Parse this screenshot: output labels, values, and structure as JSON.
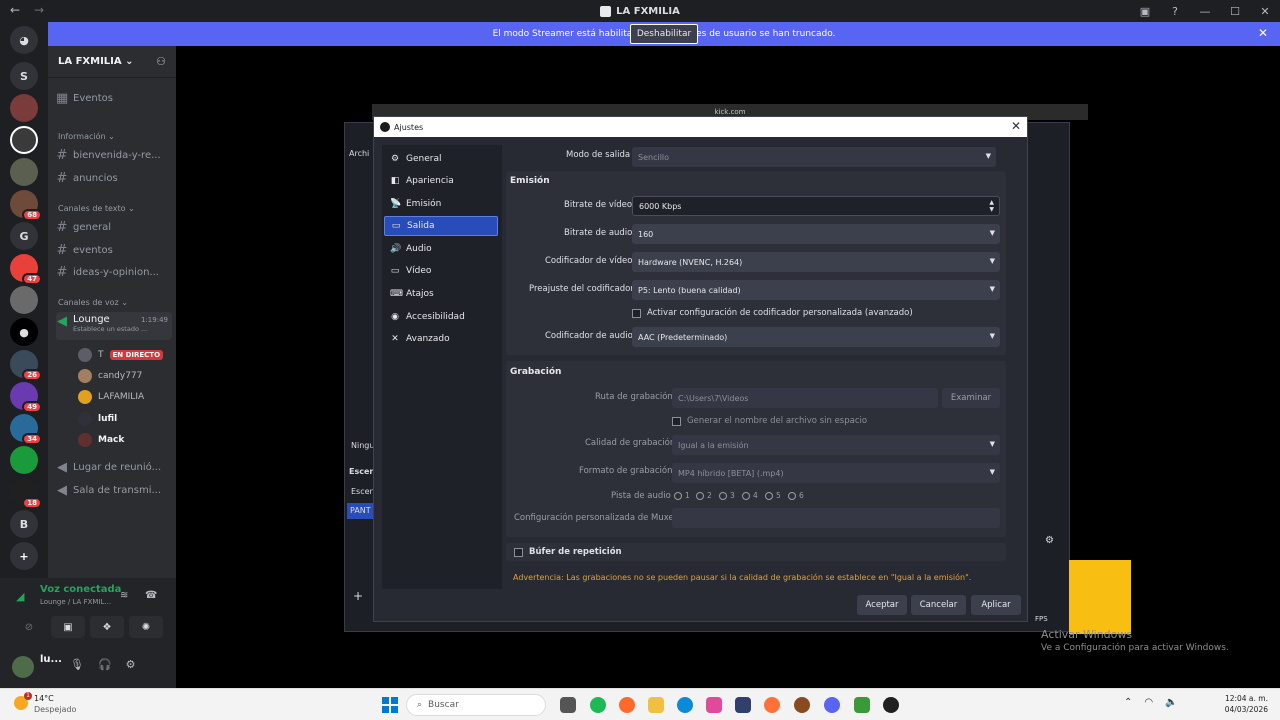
{
  "window": {
    "title": "LA FXMILIA",
    "controls": [
      "?",
      "—",
      "☐",
      "✕"
    ]
  },
  "banner": {
    "text": "El modo Streamer está habilitado. Los nombres de usuario se han truncado.",
    "button": "Deshabilitar"
  },
  "rail": {
    "letters": [
      "S",
      "G",
      "B"
    ],
    "badges": [
      "68",
      "47",
      "26",
      "49",
      "34",
      "18"
    ]
  },
  "guild": {
    "name": "LA FXMILIA"
  },
  "channels": {
    "events": "Eventos",
    "info_category": "Información",
    "info": [
      "bienvenida-y-re...",
      "anuncios"
    ],
    "text_category": "Canales de texto",
    "text": [
      "general",
      "eventos",
      "ideas-y-opinion..."
    ],
    "voice_category": "Canales de voz",
    "voice_channel": "Lounge",
    "voice_time": "1:19:49",
    "voice_status": "Establece un estado ...",
    "voice_users": [
      "T",
      "candy777",
      "LAFAMILIA",
      "lufil",
      "Mack"
    ],
    "live_label": "EN DIRECTO",
    "more": [
      "Lugar de reunió...",
      "Sala de transmi..."
    ]
  },
  "voice_panel": {
    "status": "Voz conectada",
    "sub": "Lounge / LA FXMIL...",
    "user": "lu..."
  },
  "browser": {
    "url": "kick.com"
  },
  "obs_bg": {
    "menu": "Archi",
    "scene_label": "Ningu",
    "scenes_header": "Escen",
    "scene_item": "Escen",
    "source_item": "PANT",
    "fps": "FPS"
  },
  "dialog": {
    "title": "Ajustes",
    "nav": [
      {
        "label": "General",
        "icon": "⚙"
      },
      {
        "label": "Apariencia",
        "icon": "◧"
      },
      {
        "label": "Emisión",
        "icon": "📡"
      },
      {
        "label": "Salida",
        "icon": "▭"
      },
      {
        "label": "Audio",
        "icon": "🔊"
      },
      {
        "label": "Vídeo",
        "icon": "▭"
      },
      {
        "label": "Atajos",
        "icon": "⌨"
      },
      {
        "label": "Accesibilidad",
        "icon": "◉"
      },
      {
        "label": "Avanzado",
        "icon": "✕"
      }
    ],
    "output_mode_label": "Modo de salida",
    "output_mode_value": "Sencillo",
    "streaming_section": "Emisión",
    "video_bitrate_label": "Bitrate de vídeo",
    "video_bitrate_value": "6000 Kbps",
    "audio_bitrate_label": "Bitrate de audio",
    "audio_bitrate_value": "160",
    "video_encoder_label": "Codificador de vídeo",
    "video_encoder_value": "Hardware (NVENC, H.264)",
    "preset_label": "Preajuste del codificador",
    "preset_value": "P5: Lento (buena calidad)",
    "custom_encoder_label": "Activar configuración de codificador personalizada (avanzado)",
    "audio_encoder_label": "Codificador de audio",
    "audio_encoder_value": "AAC (Predeterminado)",
    "recording_section": "Grabación",
    "rec_path_label": "Ruta de grabación",
    "rec_path_value": "C:\\Users\\7\\Videos",
    "browse_label": "Examinar",
    "no_space_label": "Generar el nombre del archivo sin espacio",
    "rec_quality_label": "Calidad de grabación",
    "rec_quality_value": "Igual a la emisión",
    "rec_format_label": "Formato de grabación",
    "rec_format_value": "MP4 híbrido [BETA] (.mp4)",
    "audio_track_label": "Pista de audio",
    "audio_tracks": [
      "1",
      "2",
      "3",
      "4",
      "5",
      "6"
    ],
    "muxer_label": "Configuración personalizada de Muxer",
    "replay_label": "Búfer de repetición",
    "warning": "Advertencia: Las grabaciones no se pueden pausar si la calidad de grabación se establece en \"Igual a la emisión\".",
    "btn_ok": "Aceptar",
    "btn_cancel": "Cancelar",
    "btn_apply": "Aplicar"
  },
  "activation": {
    "title": "Activar Windows",
    "sub": "Ve a Configuración para activar Windows."
  },
  "taskbar": {
    "temp": "14°C",
    "weather": "Despejado",
    "search_placeholder": "Buscar",
    "time": "12:04 a. m.",
    "date": "04/03/2026"
  }
}
